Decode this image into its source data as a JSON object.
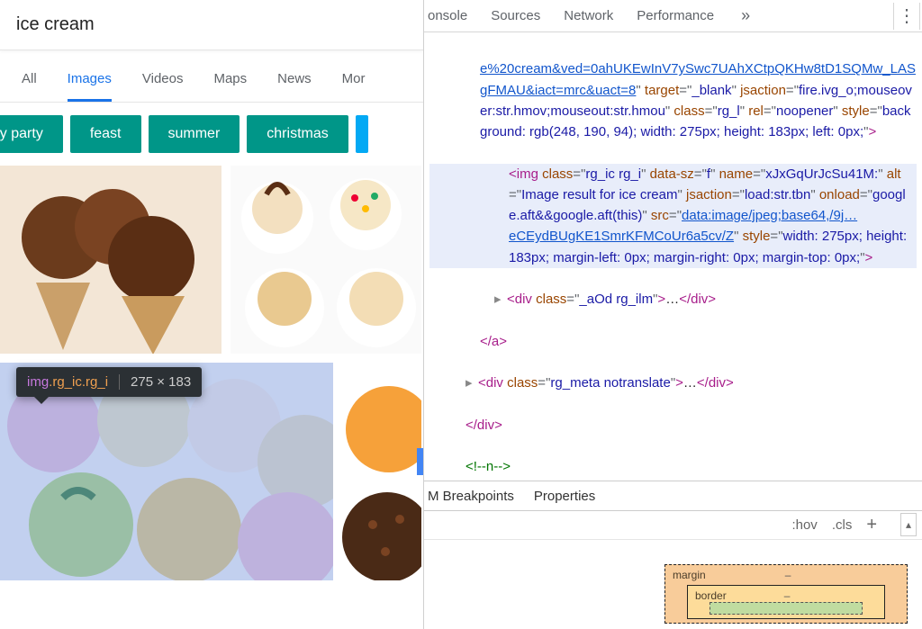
{
  "search": {
    "query": "ice cream"
  },
  "nav_tabs": {
    "all": "All",
    "images": "Images",
    "videos": "Videos",
    "maps": "Maps",
    "news": "News",
    "more": "Mor"
  },
  "active_tab": "Images",
  "chips": [
    "day party",
    "feast",
    "summer",
    "christmas"
  ],
  "inspect_tip": {
    "tag": "img",
    "classes": ".rg_ic.rg_i",
    "dimensions": "275 × 183"
  },
  "devtools": {
    "tabs": {
      "console": "onsole",
      "sources": "Sources",
      "network": "Network",
      "performance": "Performance"
    },
    "sub_tabs": {
      "breakpoints": "M Breakpoints",
      "properties": "Properties"
    },
    "styles_bar": {
      "hov": ":hov",
      "cls": ".cls"
    },
    "boxmodel": {
      "margin": "margin",
      "border": "border",
      "dash": "–"
    },
    "styles_stub": "",
    "html": {
      "a_href_tail": "e%20cream&ved=0ahUKEwInV7ySwc7UAhXCtpQKHw8tD1SQMw_LASgFMAU&iact=mrc&uact=8",
      "a_target": "_blank",
      "a_jsaction": "fire.ivg_o;mouseover:str.hmov;mouseout:str.hmou",
      "a_class": "rg_l",
      "a_rel": "noopener",
      "a_style": "background: rgb(248, 190, 94); width: 275px; height: 183px; left: 0px;",
      "img_class": "rg_ic rg_i",
      "img_data_sz": "f",
      "img_name": "xJxGqUrJcSu41M:",
      "img_alt": "Image result for ice cream",
      "img_jsaction": "load:str.tbn",
      "img_onload": "google.aft&&google.aft(this)",
      "img_src_a": "data:image/jpeg;base64,/9j…",
      "img_src_b": "eCEydBUgKE1SmrKFMCoUr6a5cv/Z",
      "img_style": "width: 275px; height: 183px; margin-left: 0px; margin-right: 0px; margin-top: 0px;",
      "div_ilm_class": "_aOd rg_ilm",
      "div_meta_class": "rg_meta notranslate",
      "comment": "n"
    }
  }
}
